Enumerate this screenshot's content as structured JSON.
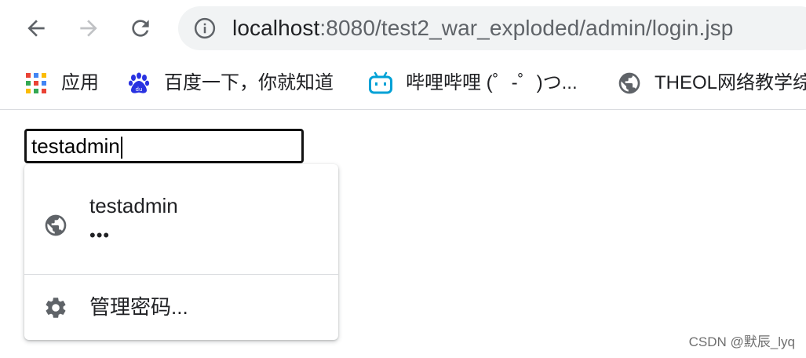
{
  "toolbar": {
    "back_icon": "arrow-left-icon",
    "forward_icon": "arrow-right-icon",
    "reload_icon": "reload-icon",
    "site_info_icon": "info-icon",
    "url_host": "localhost",
    "url_rest": ":8080/test2_war_exploded/admin/login.jsp"
  },
  "bookmarks": [
    {
      "label": "应用",
      "icon": "apps-grid-icon"
    },
    {
      "label": "百度一下，你就知道",
      "icon": "baidu-paw-icon"
    },
    {
      "label": "哔哩哔哩 (゜-゜)つ...",
      "icon": "bilibili-tv-icon"
    },
    {
      "label": "THEOL网络教学综",
      "icon": "globe-icon"
    }
  ],
  "page": {
    "login_value": "testadmin"
  },
  "autofill": {
    "username": "testadmin",
    "password_mask": "•••",
    "manage_label": "管理密码..."
  },
  "watermark": "CSDN @默辰_lyq",
  "colors": {
    "icon_gray": "#5f6368",
    "omnibox_bg": "#f1f3f4",
    "bilibili_blue": "#00a1d6",
    "baidu_blue": "#2932e1"
  }
}
